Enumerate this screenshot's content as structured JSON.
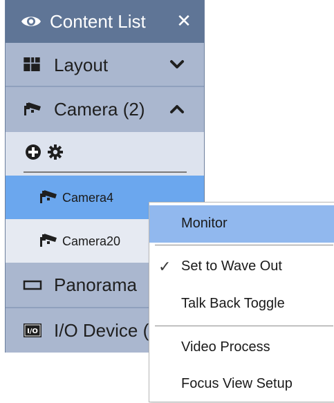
{
  "panel": {
    "title": "Content List",
    "title_icon": "eye-icon",
    "close_glyph": "✕"
  },
  "sections": {
    "layout": {
      "label": "Layout",
      "icon": "layout-grid-icon",
      "state": "collapsed"
    },
    "camera": {
      "label": "Camera (2)",
      "icon": "camera-icon",
      "state": "expanded"
    },
    "panorama": {
      "label": "Panorama",
      "icon": "panorama-icon"
    },
    "io_device": {
      "label": "I/O Device (",
      "icon": "io-device-icon",
      "icon_text": "I/O"
    }
  },
  "camera_toolbar": {
    "icons": [
      "add-circle-icon",
      "gear-icon"
    ]
  },
  "camera_items": [
    {
      "label": "Camera4",
      "selected": true
    },
    {
      "label": "Camera20",
      "selected": false
    }
  ],
  "context_menu": {
    "items": [
      {
        "label": "Monitor",
        "highlighted": true
      },
      {
        "label": "Set to Wave Out",
        "checked": true,
        "check_glyph": "✓"
      },
      {
        "label": "Talk Back Toggle"
      },
      {
        "label": "Video Process"
      },
      {
        "label": "Focus View Setup"
      }
    ]
  },
  "colors": {
    "title_bar": "#5f7596",
    "panel_bg": "#7f92b0",
    "section_bg": "#aab7cf",
    "toolbar_bg": "#dde3ee",
    "selected_item": "#6ba7ee",
    "menu_highlight": "#91b8ee"
  }
}
